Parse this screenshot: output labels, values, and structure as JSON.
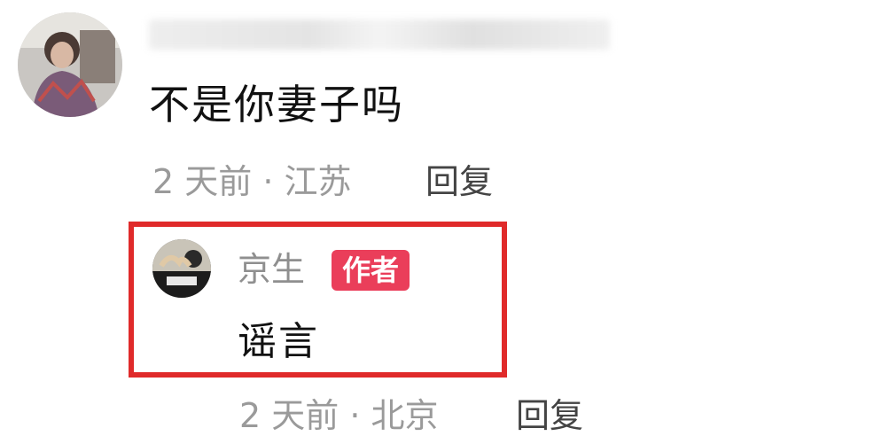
{
  "comment": {
    "text": "不是你妻子吗",
    "meta": "2 天前 · 江苏",
    "reply_label": "回复"
  },
  "reply": {
    "author": "京生",
    "badge": "作者",
    "text": "谣言",
    "meta": "2 天前 · 北京",
    "reply_label": "回复"
  },
  "colors": {
    "highlight_border": "#e02a2a",
    "badge_bg": "#ea3e5a",
    "meta_text": "#9a9a9a"
  }
}
